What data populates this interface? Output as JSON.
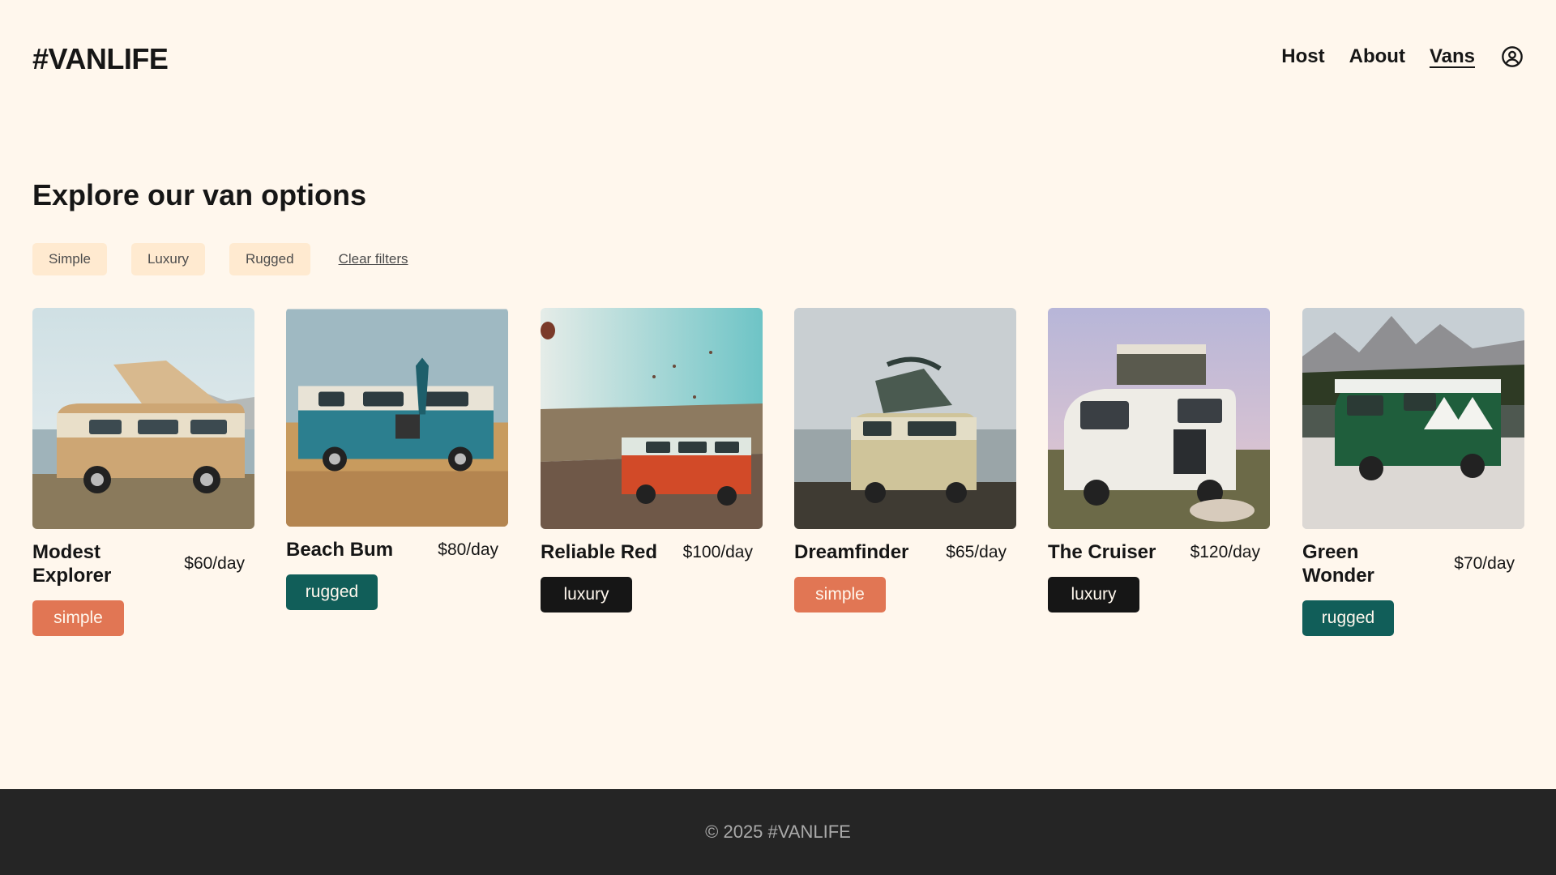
{
  "header": {
    "logo": "#VANLIFE",
    "nav": [
      {
        "label": "Host"
      },
      {
        "label": "About"
      },
      {
        "label": "Vans",
        "active": true
      }
    ],
    "user_icon": "user-circle-icon"
  },
  "main": {
    "title": "Explore our van options",
    "filters": [
      "Simple",
      "Luxury",
      "Rugged"
    ],
    "clear_filters": "Clear filters",
    "vans": [
      {
        "name": "Modest Explorer",
        "price": "$60/day",
        "type": "simple"
      },
      {
        "name": "Beach Bum",
        "price": "$80/day",
        "type": "rugged"
      },
      {
        "name": "Reliable Red",
        "price": "$100/day",
        "type": "luxury"
      },
      {
        "name": "Dreamfinder",
        "price": "$65/day",
        "type": "simple"
      },
      {
        "name": "The Cruiser",
        "price": "$120/day",
        "type": "luxury"
      },
      {
        "name": "Green Wonder",
        "price": "$70/day",
        "type": "rugged"
      }
    ]
  },
  "colors": {
    "background": "#FFF7ED",
    "simple": "#E17654",
    "rugged": "#115E59",
    "luxury": "#161616",
    "filter_bg": "#FFEAD0",
    "footer_bg": "#252525"
  },
  "footer": {
    "text": "© 2025 #VANLIFE"
  }
}
